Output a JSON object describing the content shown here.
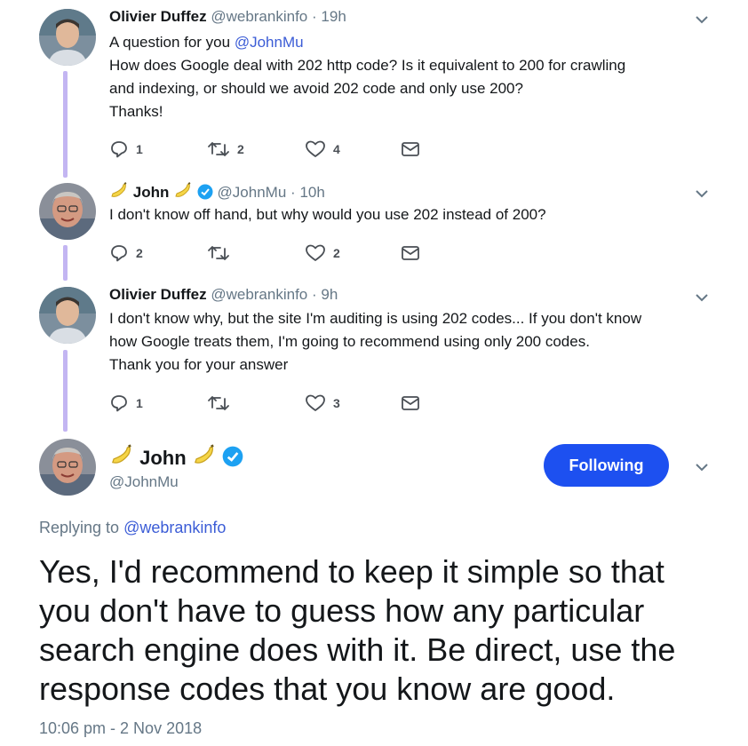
{
  "tweets": [
    {
      "name": "Olivier Duffez",
      "handle": "@webrankinfo",
      "sep": "·",
      "time": "19h",
      "lines": [
        "A question for you ",
        "How does Google deal with 202 http code? Is it equivalent to 200 for crawling",
        "and indexing, or should we avoid 202 code and only use 200?",
        "Thanks!"
      ],
      "mention": "@JohnMu",
      "reply_count": "1",
      "retweet_count": "2",
      "like_count": "4"
    },
    {
      "name": "John",
      "handle": "@JohnMu",
      "sep": "·",
      "time": "10h",
      "lines": [
        "I don't know off hand, but why would you use 202 instead of 200?"
      ],
      "reply_count": "2",
      "retweet_count": "",
      "like_count": "2"
    },
    {
      "name": "Olivier Duffez",
      "handle": "@webrankinfo",
      "sep": "·",
      "time": "9h",
      "lines": [
        "I don't know why, but the site I'm auditing is using 202 codes... If you don't know",
        "how Google treats them, I'm going to recommend using only 200 codes.",
        "Thank you for your answer"
      ],
      "reply_count": "1",
      "retweet_count": "",
      "like_count": "3"
    }
  ],
  "main_tweet": {
    "name": "John",
    "handle": "@JohnMu",
    "follow_label": "Following",
    "replying_prefix": "Replying to ",
    "replying_to": "@webrankinfo",
    "text_lines": [
      "Yes, I'd recommend to keep it simple so that",
      "you don't have to guess how any particular",
      "search engine does with it. Be direct, use the",
      "response codes that you know are good."
    ],
    "timestamp": "10:06 pm - 2 Nov 2018"
  },
  "colors": {
    "accent": "#1d50f0",
    "thread_line": "#c3b5f2",
    "muted": "#657786",
    "verified": "#1da1f2"
  },
  "icons": [
    "reply-icon",
    "retweet-icon",
    "like-icon",
    "message-icon",
    "caret-down-icon",
    "verified-icon",
    "banana-emoji"
  ]
}
